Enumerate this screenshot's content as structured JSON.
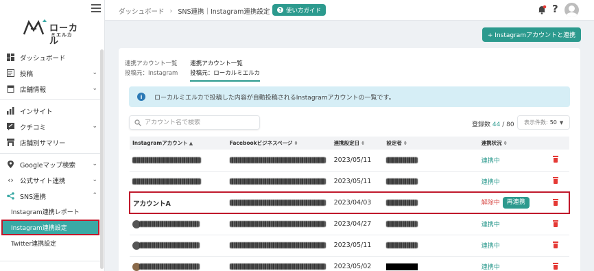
{
  "sidebar": {
    "logo_text": "ローカル",
    "logo_sub": "ミエルカ",
    "items": [
      {
        "label": "ダッシュボード",
        "icon": "dashboard-icon"
      },
      {
        "label": "投稿",
        "icon": "post-icon"
      },
      {
        "label": "店舗情報",
        "icon": "store-icon"
      },
      {
        "label": "インサイト",
        "icon": "insight-icon"
      },
      {
        "label": "クチコミ",
        "icon": "review-icon"
      },
      {
        "label": "店舗別サマリー",
        "icon": "summary-icon"
      },
      {
        "label": "Googleマップ検索",
        "icon": "map-pin-icon"
      },
      {
        "label": "公式サイト連携",
        "icon": "code-icon"
      },
      {
        "label": "SNS連携",
        "icon": "share-icon"
      }
    ],
    "sub_items": [
      {
        "label": "Instagram連携レポート"
      },
      {
        "label": "Instagram連携設定"
      },
      {
        "label": "Twitter連携設定"
      }
    ]
  },
  "topbar": {
    "crumb_home": "ダッシュボード",
    "crumb_current": "SNS連携｜Instagram連携設定",
    "guide_label": "使い方ガイド",
    "help_label": "?"
  },
  "main": {
    "add_button": "+ Instagramアカウントと連携",
    "tabs": [
      {
        "line1": "連携アカウント一覧",
        "line2": "投稿元：Instagram"
      },
      {
        "line1": "連携アカウント一覧",
        "line2": "投稿元：ローカルミエルカ"
      }
    ],
    "info_text": "ローカルミエルカで投稿した内容が自動投稿されるInstagramアカウントの一覧です。",
    "search_placeholder": "アカウント名で検索",
    "count_label": "登録数",
    "count_current": "44",
    "count_total": "/ 80",
    "perpage_label": "表示件数:",
    "perpage_value": "50",
    "columns": [
      "Instagramアカウント",
      "Facebookビジネスページ",
      "連携設定日",
      "設定者",
      "連携状況"
    ],
    "rows": [
      {
        "date": "2023/05/11",
        "status": "連携中"
      },
      {
        "date": "2023/05/11",
        "status": "連携中"
      },
      {
        "account": "アカウントA",
        "date": "2023/04/03",
        "status": "解除中",
        "action": "再連携"
      },
      {
        "date": "2023/04/27",
        "status": "連携中"
      },
      {
        "date": "2023/05/11",
        "status": "連携中"
      },
      {
        "date": "2023/05/02",
        "status": "連携中"
      }
    ]
  }
}
